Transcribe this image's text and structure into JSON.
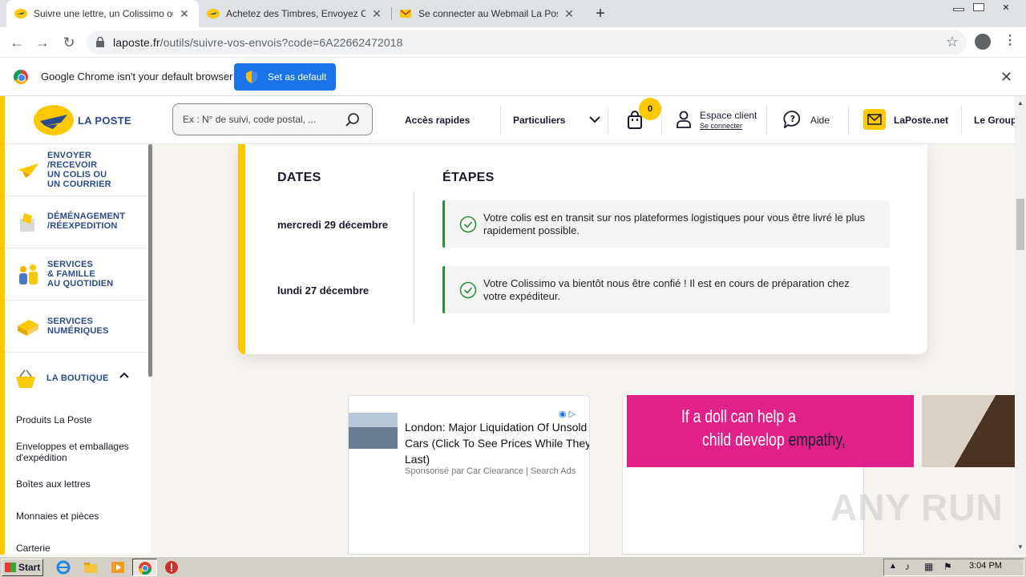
{
  "browser": {
    "tabs": [
      {
        "title": "Suivre une lettre, un Colissimo ou un",
        "active": true
      },
      {
        "title": "Achetez des Timbres, Envoyez Courr",
        "active": false
      },
      {
        "title": "Se connecter au Webmail La Poste -",
        "active": false
      }
    ],
    "url_host": "laposte.fr",
    "url_path": "/outils/suivre-vos-envois?code=6A22662472018",
    "infobar_text": "Google Chrome isn't your default browser",
    "set_default_label": "Set as default"
  },
  "header": {
    "logo_text": "LA POSTE",
    "search_placeholder": "Ex : N° de suivi, code postal, ...",
    "quick_access": "Accès rapides",
    "segment": "Particuliers",
    "cart_count": "0",
    "account_title": "Espace client",
    "account_link": "Se connecter",
    "help": "Aide",
    "laposte_net": "LaPoste.net",
    "group": "Le Group"
  },
  "sidebar": {
    "items": [
      {
        "label": "ENVOYER\n/RECEVOIR\nUN COLIS OU\nUN COURRIER",
        "icon": "plane-icon"
      },
      {
        "label": "DÉMÉNAGEMENT\n/RÉEXPEDITION",
        "icon": "moving-box-icon"
      },
      {
        "label": "SERVICES\n& FAMILLE\nAU QUOTIDIEN",
        "icon": "family-icon"
      },
      {
        "label": "SERVICES\nNUMÉRIQUES",
        "icon": "digital-icon"
      },
      {
        "label": "LA BOUTIQUE",
        "icon": "shop-basket-icon"
      }
    ],
    "shop_sub": [
      "Produits La Poste",
      "Enveloppes et emballages d'expédition",
      "Boîtes aux lettres",
      "Monnaies et pièces",
      "Carterie"
    ]
  },
  "tracking": {
    "dates_header": "DATES",
    "steps_header": "ÉTAPES",
    "events": [
      {
        "date": "mercredi 29 décembre",
        "text": "Votre colis est en transit sur nos plateformes logistiques pour vous être livré le plus rapidement possible."
      },
      {
        "date": "lundi 27 décembre",
        "text": "Votre Colissimo va bientôt nous être confié ! Il est en cours de préparation chez votre expéditeur."
      }
    ]
  },
  "ads": {
    "ad1_headline": "London: Major Liquidation Of Unsold Cars (Click To See Prices While They Last)",
    "ad1_sponsor": "Sponsorisé par Car Clearance | Search Ads",
    "ad2_line1": "If a doll can help a",
    "ad2_line2a": "child develop ",
    "ad2_line2b": "empathy,"
  },
  "watermark": "ANY RUN",
  "taskbar": {
    "start": "Start",
    "clock": "3:04 PM"
  },
  "colors": {
    "brand_yellow": "#fcc800",
    "brand_blue": "#2b4a8c",
    "step_green": "#2e8b3d",
    "chrome_blue": "#1a73e8"
  }
}
